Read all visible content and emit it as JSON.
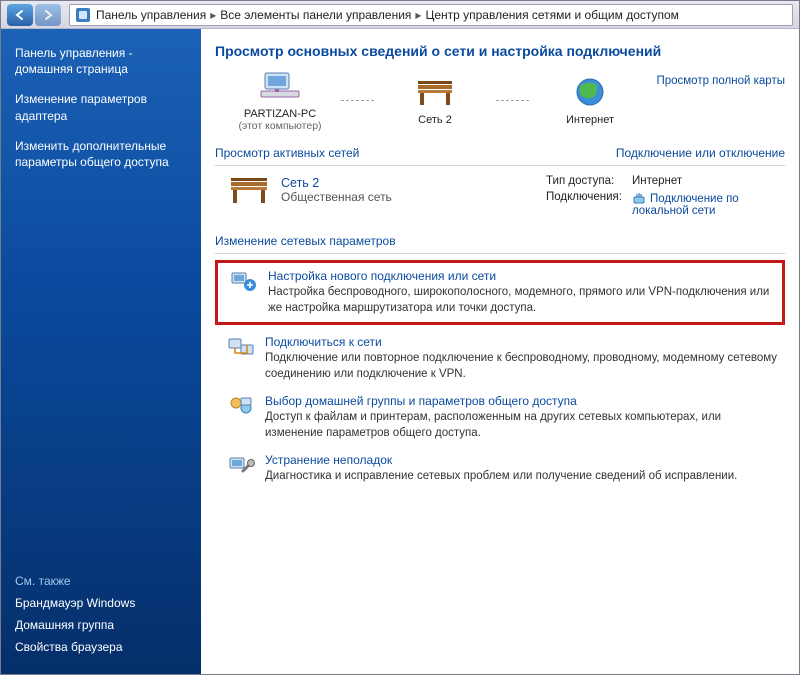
{
  "breadcrumbs": {
    "a": "Панель управления",
    "b": "Все элементы панели управления",
    "c": "Центр управления сетями и общим доступом"
  },
  "sidebar": {
    "home": "Панель управления - домашняя страница",
    "links": {
      "0": "Изменение параметров адаптера",
      "1": "Изменить дополнительные параметры общего доступа"
    },
    "see_also_heading": "См. также",
    "see_also": {
      "0": "Брандмауэр Windows",
      "1": "Домашняя группа",
      "2": "Свойства браузера"
    }
  },
  "main": {
    "title": "Просмотр основных сведений о сети и настройка подключений",
    "map": {
      "pc_name": "PARTIZAN-PC",
      "pc_sub": "(этот компьютер)",
      "net_name": "Сеть 2",
      "internet": "Интернет",
      "full_map": "Просмотр полной карты"
    },
    "active_heading": "Просмотр активных сетей",
    "connect_link": "Подключение или отключение",
    "active": {
      "name": "Сеть 2",
      "type": "Общественная сеть",
      "row1_label": "Тип доступа:",
      "row1_value": "Интернет",
      "row2_label": "Подключения:",
      "row2_value": "Подключение по локальной сети"
    },
    "change_heading": "Изменение сетевых параметров",
    "tasks": {
      "0": {
        "title": "Настройка нового подключения или сети",
        "desc": "Настройка беспроводного, широкополосного, модемного, прямого или VPN-подключения или же настройка маршрутизатора или точки доступа."
      },
      "1": {
        "title": "Подключиться к сети",
        "desc": "Подключение или повторное подключение к беспроводному, проводному, модемному сетевому соединению или подключение к VPN."
      },
      "2": {
        "title": "Выбор домашней группы и параметров общего доступа",
        "desc": "Доступ к файлам и принтерам, расположенным на других сетевых компьютерах, или изменение параметров общего доступа."
      },
      "3": {
        "title": "Устранение неполадок",
        "desc": "Диагностика и исправление сетевых проблем или получение сведений об исправлении."
      }
    }
  }
}
